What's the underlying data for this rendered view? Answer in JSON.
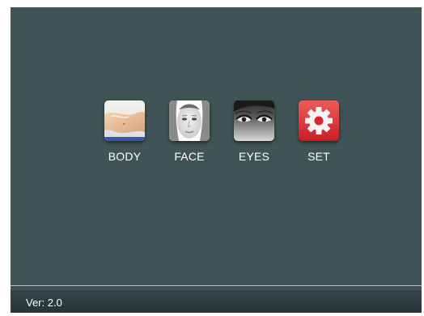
{
  "menu": {
    "items": [
      {
        "label": "BODY",
        "icon": "body-icon"
      },
      {
        "label": "FACE",
        "icon": "face-icon"
      },
      {
        "label": "EYES",
        "icon": "eyes-icon"
      },
      {
        "label": "SET",
        "icon": "gear-icon"
      }
    ]
  },
  "footer": {
    "version": "Ver: 2.0"
  },
  "colors": {
    "background": "#405457",
    "footer": "#2b3a3e",
    "set_tile": "#e23a3a"
  }
}
